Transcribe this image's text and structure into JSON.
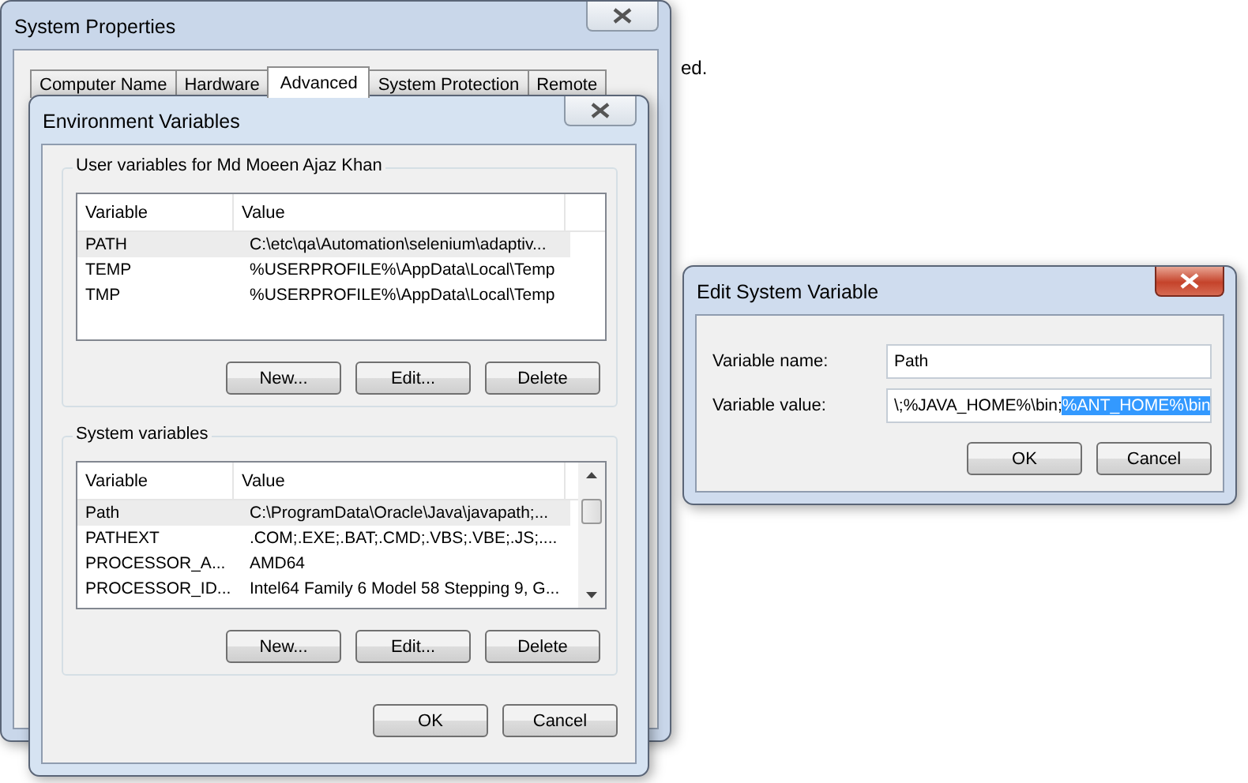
{
  "background_text": "ed.",
  "system_properties": {
    "title": "System Properties",
    "tabs": [
      {
        "label": "Computer Name",
        "selected": false
      },
      {
        "label": "Hardware",
        "selected": false
      },
      {
        "label": "Advanced",
        "selected": true
      },
      {
        "label": "System Protection",
        "selected": false
      },
      {
        "label": "Remote",
        "selected": false
      }
    ]
  },
  "environment_variables": {
    "title": "Environment Variables",
    "user_variables": {
      "legend": "User variables for Md Moeen Ajaz Khan",
      "columns": [
        "Variable",
        "Value"
      ],
      "rows": [
        {
          "variable": "PATH",
          "value": "C:\\etc\\qa\\Automation\\selenium\\adaptiv...",
          "selected": true
        },
        {
          "variable": "TEMP",
          "value": "%USERPROFILE%\\AppData\\Local\\Temp",
          "selected": false
        },
        {
          "variable": "TMP",
          "value": "%USERPROFILE%\\AppData\\Local\\Temp",
          "selected": false
        }
      ],
      "buttons": [
        "New...",
        "Edit...",
        "Delete"
      ]
    },
    "system_variables": {
      "legend": "System variables",
      "columns": [
        "Variable",
        "Value"
      ],
      "rows": [
        {
          "variable": "Path",
          "value": "C:\\ProgramData\\Oracle\\Java\\javapath;...",
          "selected": true
        },
        {
          "variable": "PATHEXT",
          "value": ".COM;.EXE;.BAT;.CMD;.VBS;.VBE;.JS;....",
          "selected": false
        },
        {
          "variable": "PROCESSOR_A...",
          "value": "AMD64",
          "selected": false
        },
        {
          "variable": "PROCESSOR_ID...",
          "value": "Intel64 Family 6 Model 58 Stepping 9, G...",
          "selected": false
        }
      ],
      "buttons": [
        "New...",
        "Edit...",
        "Delete"
      ]
    },
    "buttons": [
      "OK",
      "Cancel"
    ]
  },
  "edit_system_variable": {
    "title": "Edit System Variable",
    "name_label": "Variable name:",
    "name_value": "Path",
    "value_label": "Variable value:",
    "value_text": "\\;%JAVA_HOME%\\bin;",
    "value_selected_text": "%ANT_HOME%\\bin",
    "buttons": [
      "OK",
      "Cancel"
    ]
  }
}
